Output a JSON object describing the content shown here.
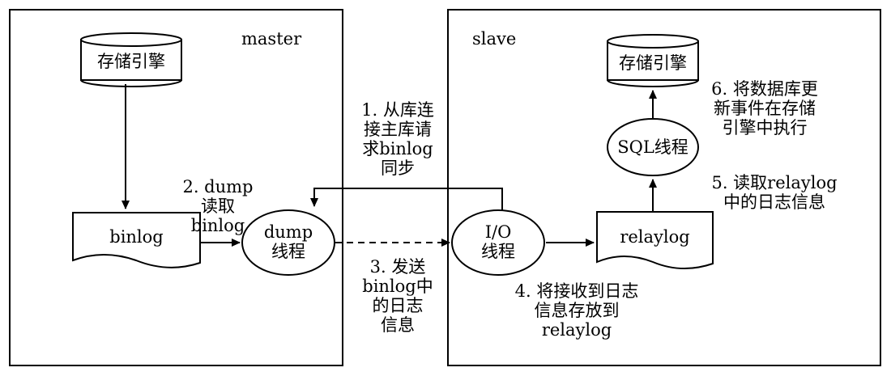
{
  "master": {
    "title": "master",
    "storage": "存储引擎",
    "binlog": "binlog",
    "dump_thread": "dump\n线程"
  },
  "slave": {
    "title": "slave",
    "storage": "存储引擎",
    "sql_thread": "SQL线程",
    "io_thread": "I/O\n线程",
    "relaylog": "relaylog"
  },
  "steps": {
    "s1": "1. 从库连\n接主库请\n求binlog\n同步",
    "s2": "2. dump\n读取\nbinlog",
    "s3": "3. 发送\nbinlog中\n的日志\n信息",
    "s4": "4. 将接收到日志\n信息存放到\nrelaylog",
    "s5": "5. 读取relaylog\n中的日志信息",
    "s6": "6. 将数据库更\n新事件在存储\n引擎中执行"
  },
  "colors": {
    "stroke": "#000000",
    "fill": "#ffffff"
  }
}
